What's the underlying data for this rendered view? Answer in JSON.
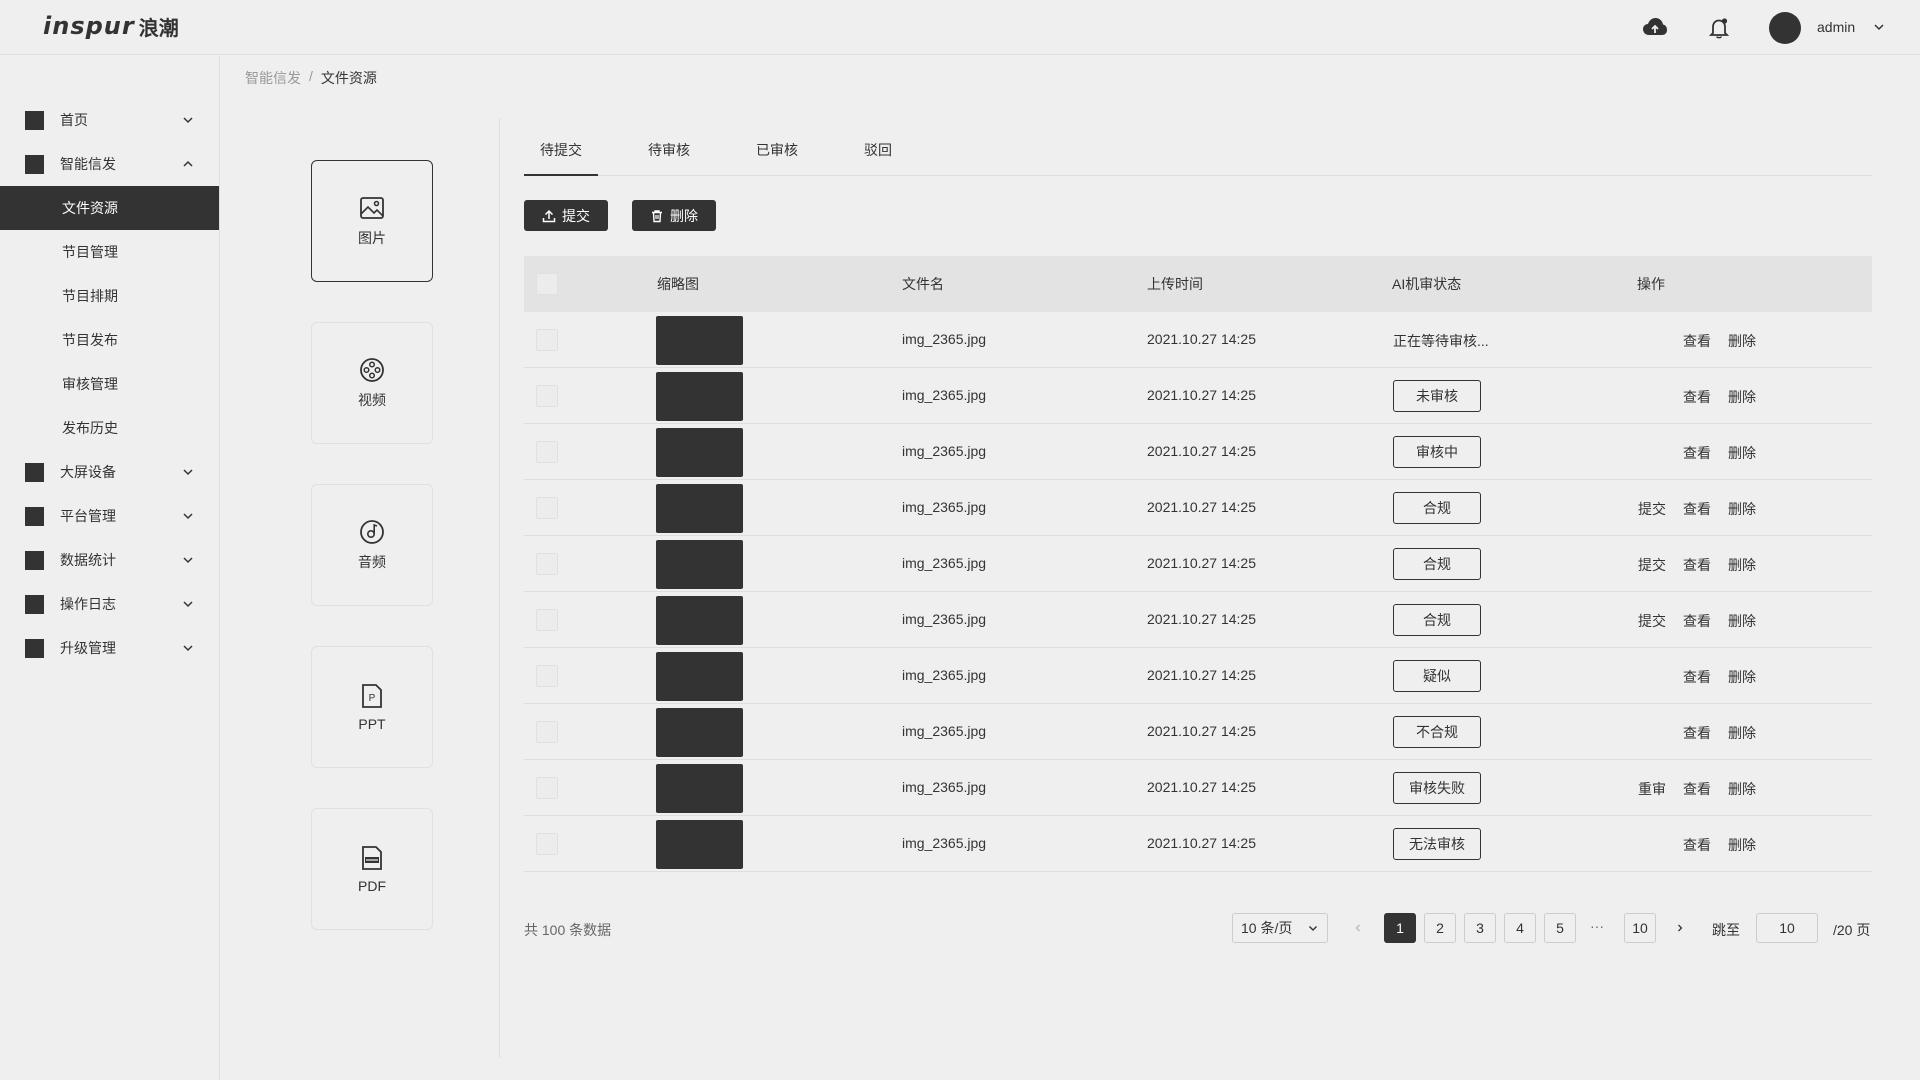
{
  "header": {
    "logo_en": "inspur",
    "logo_cn": "浪潮",
    "username": "admin",
    "icons": [
      "cloud-upload-icon",
      "bell-icon",
      "chevron-down-icon"
    ]
  },
  "sidebar": {
    "items": [
      {
        "label": "首页",
        "expanded": false
      },
      {
        "label": "智能信发",
        "expanded": true
      },
      {
        "label": "大屏设备",
        "expanded": false
      },
      {
        "label": "平台管理",
        "expanded": false
      },
      {
        "label": "数据统计",
        "expanded": false
      },
      {
        "label": "操作日志",
        "expanded": false
      },
      {
        "label": "升级管理",
        "expanded": false
      }
    ],
    "submenu": [
      "文件资源",
      "节目管理",
      "节目排期",
      "节目发布",
      "审核管理",
      "发布历史"
    ],
    "active_sub": "文件资源"
  },
  "breadcrumb": {
    "parent": "智能信发",
    "separator": "/",
    "current": "文件资源"
  },
  "categories": [
    {
      "label": "图片",
      "icon": "image-icon",
      "active": true
    },
    {
      "label": "视频",
      "icon": "film-reel-icon",
      "active": false
    },
    {
      "label": "音频",
      "icon": "audio-disc-icon",
      "active": false
    },
    {
      "label": "PPT",
      "icon": "ppt-file-icon",
      "active": false
    },
    {
      "label": "PDF",
      "icon": "pdf-file-icon",
      "active": false
    }
  ],
  "tabs": [
    {
      "label": "待提交",
      "active": true
    },
    {
      "label": "待审核",
      "active": false
    },
    {
      "label": "已审核",
      "active": false
    },
    {
      "label": "驳回",
      "active": false
    }
  ],
  "toolbar": {
    "submit_label": "提交",
    "delete_label": "删除"
  },
  "table": {
    "headers": [
      "缩略图",
      "文件名",
      "上传时间",
      "AI机审状态",
      "操作"
    ],
    "rows": [
      {
        "filename": "img_2365.jpg",
        "time": "2021.10.27  14:25",
        "status": "正在等待审核...",
        "boxed": false,
        "actions": [
          "查看",
          "删除"
        ]
      },
      {
        "filename": "img_2365.jpg",
        "time": "2021.10.27  14:25",
        "status": "未审核",
        "boxed": true,
        "actions": [
          "查看",
          "删除"
        ]
      },
      {
        "filename": "img_2365.jpg",
        "time": "2021.10.27  14:25",
        "status": "审核中",
        "boxed": true,
        "actions": [
          "查看",
          "删除"
        ]
      },
      {
        "filename": "img_2365.jpg",
        "time": "2021.10.27  14:25",
        "status": "合规",
        "boxed": true,
        "actions": [
          "提交",
          "查看",
          "删除"
        ]
      },
      {
        "filename": "img_2365.jpg",
        "time": "2021.10.27  14:25",
        "status": "合规",
        "boxed": true,
        "actions": [
          "提交",
          "查看",
          "删除"
        ]
      },
      {
        "filename": "img_2365.jpg",
        "time": "2021.10.27  14:25",
        "status": "合规",
        "boxed": true,
        "actions": [
          "提交",
          "查看",
          "删除"
        ]
      },
      {
        "filename": "img_2365.jpg",
        "time": "2021.10.27  14:25",
        "status": "疑似",
        "boxed": true,
        "actions": [
          "查看",
          "删除"
        ]
      },
      {
        "filename": "img_2365.jpg",
        "time": "2021.10.27  14:25",
        "status": "不合规",
        "boxed": true,
        "actions": [
          "查看",
          "删除"
        ]
      },
      {
        "filename": "img_2365.jpg",
        "time": "2021.10.27  14:25",
        "status": "审核失败",
        "boxed": true,
        "actions": [
          "重审",
          "查看",
          "删除"
        ]
      },
      {
        "filename": "img_2365.jpg",
        "time": "2021.10.27  14:25",
        "status": "无法审核",
        "boxed": true,
        "actions": [
          "查看",
          "删除"
        ]
      }
    ]
  },
  "pagination": {
    "total_text": "共 100 条数据",
    "page_size": "10 条/页",
    "pages": [
      "1",
      "2",
      "3",
      "4",
      "5"
    ],
    "ellipsis": "···",
    "last_page": "10",
    "current": "1",
    "goto_label": "跳至",
    "goto_value": "10",
    "pages_total": "/20 页"
  },
  "colors": {
    "background": "#efefef",
    "dark": "#333333",
    "border": "#dedede"
  }
}
